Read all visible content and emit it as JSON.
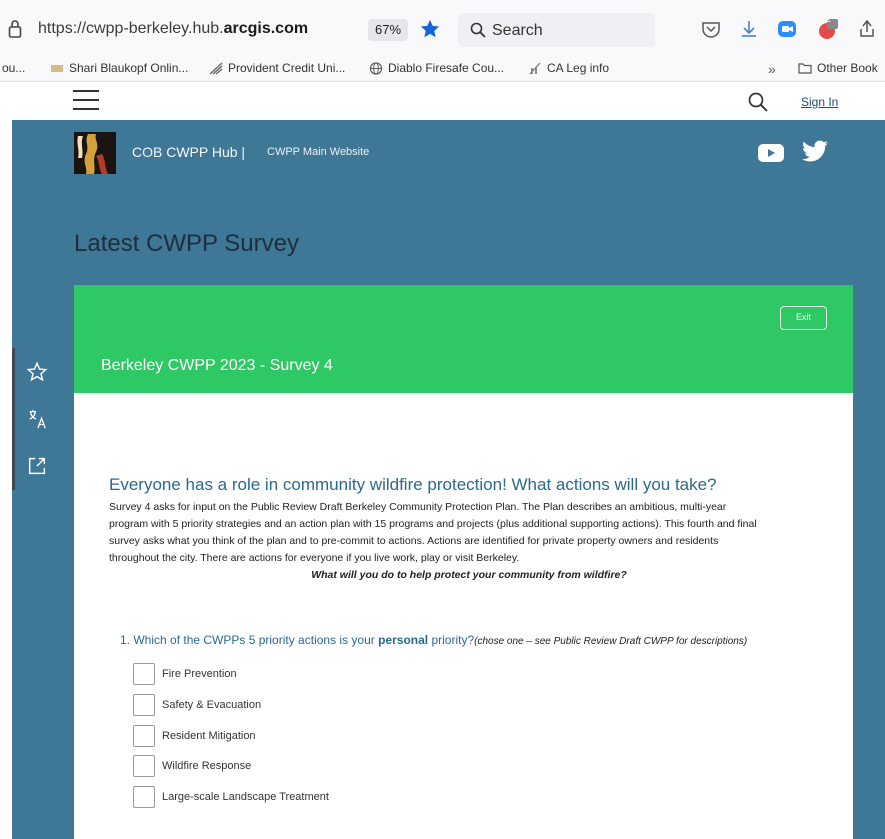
{
  "browser": {
    "url_prefix": "https://cwpp-berkeley.hub.",
    "url_domain": "arcgis.com",
    "zoom": "67%",
    "search_label": "Search",
    "extensions_badge": "2",
    "bookmarks": [
      "ou...",
      "Shari Blaukopf Onlin...",
      "Provident Credit Uni...",
      "Diablo Firesafe Cou...",
      "CA Leg info"
    ],
    "other_bookmarks": "Other Book"
  },
  "site": {
    "sign_in": "Sign In",
    "hub_name": "COB CWPP Hub |",
    "main_link": "CWPP Main Website",
    "page_title": "Latest CWPP Survey"
  },
  "survey": {
    "exit_label": "Exit",
    "title": "Berkeley CWPP 2023 - Survey 4",
    "heading": "Everyone has a role in community wildfire protection!  What actions will you take?",
    "desc_lines": [
      "Survey 4 asks for input on the Public Review Draft Berkeley Community Protection Plan.  The Plan describes an ambitious, multi-year",
      "program with 5 priority strategies and an action plan with 15 programs and projects (plus additional supporting actions).  This fourth and final",
      "survey asks what you think of the plan and to pre-commit to actions.  Actions are identified for private property owners and residents",
      "throughout the city. There are actions for everyone if you live work, play or visit Berkeley."
    ],
    "emphasis": "What will you do to help protect your community from wildfire?",
    "question": {
      "prefix": "1. Which of the CWPPs 5 priority actions is your ",
      "bold": "personal",
      "suffix": " priority?",
      "note": "(chose one – see Public Review Draft CWPP for descriptions)"
    },
    "options": [
      "Fire Prevention",
      "Safety & Evacuation",
      "Resident Mitigation",
      "Wildfire Response",
      "Large-scale Landscape Treatment"
    ]
  },
  "colors": {
    "hub_background": "#3f7796",
    "survey_header": "#2ec864",
    "heading_text": "#2a6a8e"
  }
}
